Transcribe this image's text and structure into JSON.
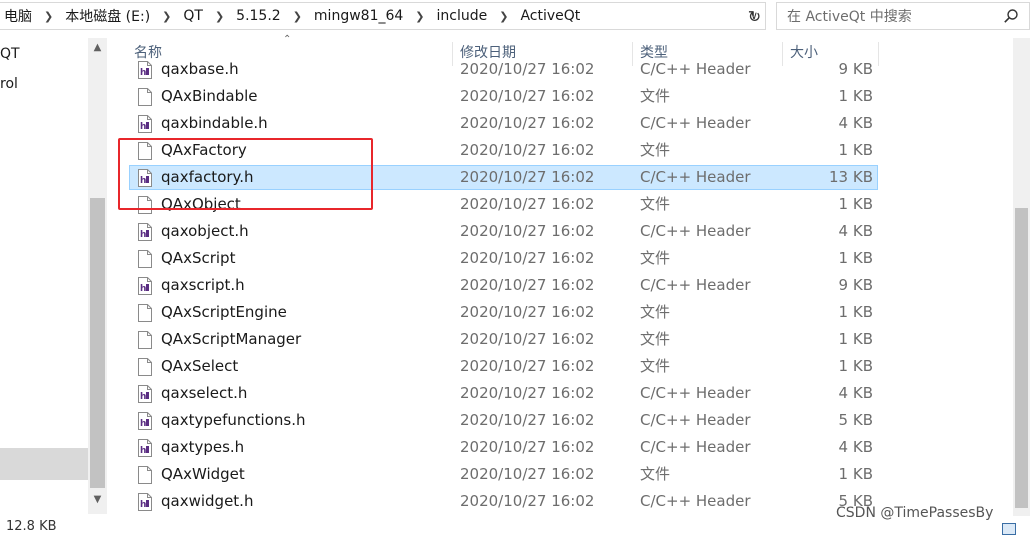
{
  "address_bar": {
    "crumbs": [
      "电脑",
      "本地磁盘 (E:)",
      "QT",
      "5.15.2",
      "mingw81_64",
      "include",
      "ActiveQt"
    ]
  },
  "search": {
    "placeholder": "在 ActiveQt 中搜索"
  },
  "nav": {
    "items": [
      "QT",
      "rol"
    ]
  },
  "columns": {
    "name": "名称",
    "date": "修改日期",
    "type": "类型",
    "size": "大小"
  },
  "files": [
    {
      "name": "qaxbase.h",
      "date": "2020/10/27 16:02",
      "type": "C/C++ Header",
      "size": "9 KB",
      "icon": "header-file-icon"
    },
    {
      "name": "QAxBindable",
      "date": "2020/10/27 16:02",
      "type": "文件",
      "size": "1 KB",
      "icon": "blank-file-icon"
    },
    {
      "name": "qaxbindable.h",
      "date": "2020/10/27 16:02",
      "type": "C/C++ Header",
      "size": "4 KB",
      "icon": "header-file-icon"
    },
    {
      "name": "QAxFactory",
      "date": "2020/10/27 16:02",
      "type": "文件",
      "size": "1 KB",
      "icon": "blank-file-icon"
    },
    {
      "name": "qaxfactory.h",
      "date": "2020/10/27 16:02",
      "type": "C/C++ Header",
      "size": "13 KB",
      "icon": "header-file-icon",
      "selected": true
    },
    {
      "name": "QAxObject",
      "date": "2020/10/27 16:02",
      "type": "文件",
      "size": "1 KB",
      "icon": "blank-file-icon"
    },
    {
      "name": "qaxobject.h",
      "date": "2020/10/27 16:02",
      "type": "C/C++ Header",
      "size": "4 KB",
      "icon": "header-file-icon"
    },
    {
      "name": "QAxScript",
      "date": "2020/10/27 16:02",
      "type": "文件",
      "size": "1 KB",
      "icon": "blank-file-icon"
    },
    {
      "name": "qaxscript.h",
      "date": "2020/10/27 16:02",
      "type": "C/C++ Header",
      "size": "9 KB",
      "icon": "header-file-icon"
    },
    {
      "name": "QAxScriptEngine",
      "date": "2020/10/27 16:02",
      "type": "文件",
      "size": "1 KB",
      "icon": "blank-file-icon"
    },
    {
      "name": "QAxScriptManager",
      "date": "2020/10/27 16:02",
      "type": "文件",
      "size": "1 KB",
      "icon": "blank-file-icon"
    },
    {
      "name": "QAxSelect",
      "date": "2020/10/27 16:02",
      "type": "文件",
      "size": "1 KB",
      "icon": "blank-file-icon"
    },
    {
      "name": "qaxselect.h",
      "date": "2020/10/27 16:02",
      "type": "C/C++ Header",
      "size": "4 KB",
      "icon": "header-file-icon"
    },
    {
      "name": "qaxtypefunctions.h",
      "date": "2020/10/27 16:02",
      "type": "C/C++ Header",
      "size": "5 KB",
      "icon": "header-file-icon"
    },
    {
      "name": "qaxtypes.h",
      "date": "2020/10/27 16:02",
      "type": "C/C++ Header",
      "size": "4 KB",
      "icon": "header-file-icon"
    },
    {
      "name": "QAxWidget",
      "date": "2020/10/27 16:02",
      "type": "文件",
      "size": "1 KB",
      "icon": "blank-file-icon"
    },
    {
      "name": "qaxwidget.h",
      "date": "2020/10/27 16:02",
      "type": "C/C++ Header",
      "size": "5 KB",
      "icon": "header-file-icon"
    }
  ],
  "status": {
    "selected_size": "12.8 KB"
  },
  "watermark": "CSDN @TimePassesBy",
  "colors": {
    "selection_bg": "#cce8ff",
    "selection_border": "#99d1ff",
    "highlight_box": "#e8262b",
    "header_text": "#4c607a"
  }
}
